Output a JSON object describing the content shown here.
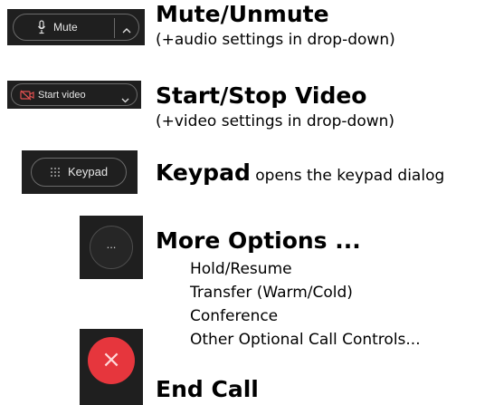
{
  "items": [
    {
      "button_label": "Mute",
      "title": "Mute/Unmute",
      "subtitle": "(+audio settings in drop-down)"
    },
    {
      "button_label": "Start video",
      "title": "Start/Stop Video",
      "subtitle": "(+video settings in drop-down)"
    },
    {
      "button_label": "Keypad",
      "title": "Keypad",
      "description": " opens the keypad dialog"
    },
    {
      "button_label": "...",
      "title": "More Options ...",
      "options": [
        "Hold/Resume",
        "Transfer (Warm/Cold)",
        "Conference",
        "Other Optional Call Controls..."
      ]
    },
    {
      "button_label": "×",
      "title": "End Call"
    }
  ],
  "colors": {
    "tile_bg": "#1f1f1f",
    "border": "#6b6b6b",
    "end_call_red": "#e6363d",
    "button_text": "#e6e6e6"
  }
}
